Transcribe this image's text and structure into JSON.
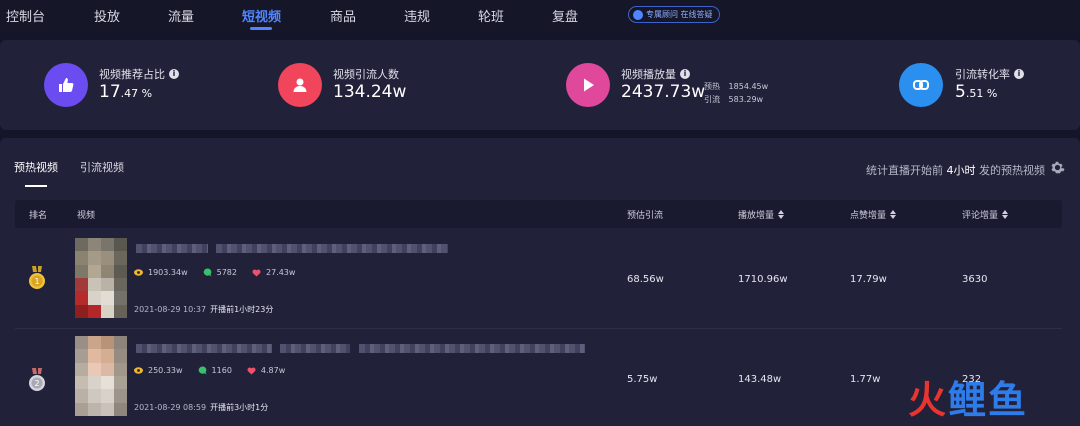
{
  "nav": {
    "items": [
      "控制台",
      "投放",
      "流量",
      "短视频",
      "商品",
      "违规",
      "轮班",
      "复盘"
    ],
    "active_index": 3,
    "consult_label": "专属顾问 在线答疑"
  },
  "stats": [
    {
      "label": "视频推荐占比",
      "value_main": "17",
      "value_small": ".47 %",
      "icon": "thumbs-up-icon",
      "color": "#6a4cf0"
    },
    {
      "label": "视频引流人数",
      "value_main": "134.24w",
      "value_small": "",
      "icon": "user-icon",
      "color": "#f0455a"
    },
    {
      "label": "视频播放量",
      "value_main": "2437.73w",
      "value_small": "",
      "icon": "play-icon",
      "color": "#e0489c",
      "sub": [
        {
          "label": "预热",
          "value": "1854.45w"
        },
        {
          "label": "引流",
          "value": "583.29w"
        }
      ]
    },
    {
      "label": "引流转化率",
      "value_main": "5",
      "value_small": ".51 %",
      "icon": "link-icon",
      "color": "#2b8ff0"
    }
  ],
  "list": {
    "tabs": [
      "预热视频",
      "引流视频"
    ],
    "active_tab": 0,
    "note_prefix": "统计直播开始前",
    "note_highlight": "4小时",
    "note_suffix": "发的预热视频",
    "columns": [
      "排名",
      "视频",
      "预估引流",
      "播放增量",
      "点赞增量",
      "评论增量"
    ],
    "rows": [
      {
        "rank": 1,
        "medal": "gold-medal-icon",
        "views": "1903.34w",
        "comments": "5782",
        "likes": "27.43w",
        "date": "2021-08-29 10:37",
        "relative": "开播前1小时23分",
        "est_traffic": "68.56w",
        "play_inc": "1710.96w",
        "like_inc": "17.79w",
        "comment_inc": "3630"
      },
      {
        "rank": 2,
        "medal": "silver-medal-icon",
        "views": "250.33w",
        "comments": "1160",
        "likes": "4.87w",
        "date": "2021-08-29 08:59",
        "relative": "开播前3小时1分",
        "est_traffic": "5.75w",
        "play_inc": "143.48w",
        "like_inc": "1.77w",
        "comment_inc": "232"
      }
    ]
  },
  "watermark": {
    "part1": "火",
    "part2": "鲤",
    "part3": "鱼"
  }
}
